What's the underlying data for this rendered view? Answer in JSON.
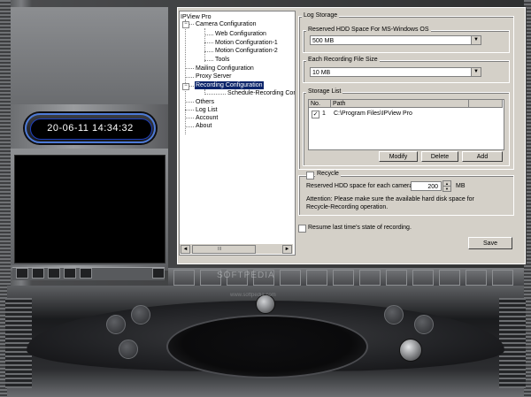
{
  "clock": {
    "datetime": "20-06-11 14:34:32"
  },
  "tree": {
    "root": "IPView Pro",
    "camera_configuration": "Camera Configuration",
    "web_configuration": "Web Configuration",
    "motion_configuration_1": "Motion Configuration-1",
    "motion_configuration_2": "Motion Configuration-2",
    "tools": "Tools",
    "mailing_configuration": "Mailing Configuration",
    "proxy_server": "Proxy Server",
    "recording_configuration": "Recording Configuration",
    "schedule_recording": "Schedule-Recording Con",
    "others": "Others",
    "log_list": "Log List",
    "account": "Account",
    "about": "About",
    "expand_minus": "−"
  },
  "scroll": {
    "left_arrow": "◄",
    "right_arrow": "►",
    "thumb_grip": "III"
  },
  "log_storage": {
    "title": "Log Storage",
    "reserved_group": "Reserved HDD Space For MS-Windows OS",
    "reserved_value": "500 MB",
    "file_size_group": "Each Recording File Size",
    "file_size_value": "10 MB",
    "dropdown_arrow": "▼"
  },
  "storage_list": {
    "title": "Storage List",
    "col_no": "No.",
    "col_path": "Path",
    "rows": [
      {
        "no": "1",
        "path": "C:\\Program Files\\IPView Pro",
        "checked": "✓"
      }
    ],
    "modify": "Modify",
    "delete": "Delete",
    "add": "Add"
  },
  "recycle": {
    "label": "Recycle",
    "reserved_label": "Reserved HDD space for each camera",
    "reserved_value": "200",
    "unit": "MB",
    "spin_up": "▲",
    "spin_down": "▼",
    "attention_1": "Attention: Please make sure the available hard disk space for",
    "attention_2": "Recycle-Recording operation."
  },
  "resume": {
    "label": "Resume last time's state of recording."
  },
  "save": {
    "label": "Save"
  },
  "watermark": {
    "text": "SOFTPEDIA",
    "small": "www.softpedia.com"
  }
}
